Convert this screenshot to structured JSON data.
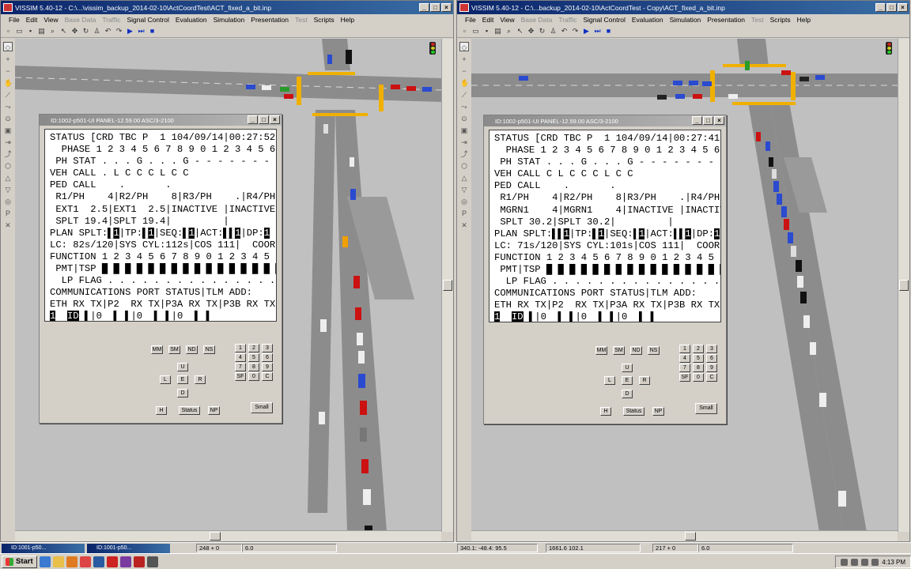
{
  "menu": [
    "File",
    "Edit",
    "View",
    "Base Data",
    "Traffic",
    "Signal Control",
    "Evaluation",
    "Simulation",
    "Presentation",
    "Test",
    "Scripts",
    "Help"
  ],
  "menu_disabled": [
    "Base Data",
    "Traffic",
    "Test"
  ],
  "windows": [
    {
      "title": "VISSIM 5.40-12 - C:\\...\\vissim_backup_2014-02-10\\ActCoordTest\\ACT_fixed_a_bit.inp",
      "panel_title": "ID:1002-p501-UI PANEL-12.59.00 ASC/3-2100",
      "lcd": {
        "l1": "STATUS [CRD TBC P  1 104/09/14|00:27:52",
        "l2": "  PHASE 1 2 3 4 5 6 7 8 9 0 1 2 3 4 5 6",
        "l3": " PH STAT . . . G . . . G - - - - - - - -",
        "l4": "VEH CALL . L C C C L C C",
        "l5": "PED CALL    .       .",
        "l6": " R1/PH    4|R2/PH    8|R3/PH    .|R4/PH    .",
        "l7": " EXT1  2.5|EXT1  2.5|INACTIVE |INACTIVE",
        "l8": " SPLT 19.4|SPLT 19.4|         |",
        "l9a": "PLAN SPLT:",
        "l9b": "|TP:",
        "l9c": "|SEQ:",
        "l9d": "|ACT:",
        "l9e": "|DP:",
        "l10": "LC: 82s/120|SYS CYL:112s|COS 111|  COORD",
        "l11": "FUNCTION 1 2 3 4 5 6 7 8 9 0 1 2 3 4 5 6",
        "l12a": " PMT|TSP ",
        "l13": "  LP FLAG . . . . . . . . . . . . . . . .",
        "l14": "COMMUNICATIONS PORT STATUS|TLM ADD:    0",
        "l15": "ETH RX TX|P2  RX TX|P3A RX TX|P3B RX TX",
        "l16a": "1",
        "l16b": "ID",
        "l16c": "0",
        "l16d": "0",
        "l16e": "0"
      }
    },
    {
      "title": "VISSIM 5.40-12 - C:\\...backup_2014-02-10\\ActCoordTest - Copy\\ACT_fixed_a_bit.inp",
      "panel_title": "ID:1002-p501-UI PANEL-12.59.00 ASC/3-2100",
      "lcd": {
        "l1": "STATUS [CRD TBC P  1 104/09/14|00:27:41",
        "l2": "  PHASE 1 2 3 4 5 6 7 8 9 0 1 2 3 4 5 6",
        "l3": " PH STAT . . . G . . . G - - - - - - - -",
        "l4": "VEH CALL C L C C C L C C",
        "l5": "PED CALL    .       .",
        "l6": " R1/PH    4|R2/PH    8|R3/PH    .|R4/PH    .",
        "l7": " MGRN1    4|MGRN1    4|INACTIVE |INACTIVE",
        "l8": " SPLT 30.2|SPLT 30.2|         |",
        "l9a": "PLAN SPLT:",
        "l9b": "|TP:",
        "l9c": "|SEQ:",
        "l9d": "|ACT:",
        "l9e": "|DP:",
        "l10": "LC: 71s/120|SYS CYL:101s|COS 111|  COORD",
        "l11": "FUNCTION 1 2 3 4 5 6 7 8 9 0 1 2 3 4 5 6",
        "l12a": " PMT|TSP ",
        "l13": "  LP FLAG . . . . . . . . . . . . . . . .",
        "l14": "COMMUNICATIONS PORT STATUS|TLM ADD:    0",
        "l15": "ETH RX TX|P2  RX TX|P3A RX TX|P3B RX TX",
        "l16a": "1",
        "l16b": "ID",
        "l16c": "0",
        "l16d": "0",
        "l16e": "0"
      }
    }
  ],
  "keypad": {
    "mode": [
      "MM",
      "SM",
      "ND",
      "NS"
    ],
    "dir_u": "U",
    "dir_l": "L",
    "dir_e": "E",
    "dir_r": "R",
    "dir_d": "D",
    "h": "H",
    "status": "Status",
    "np": "NP",
    "small": "Small",
    "num": [
      "1",
      "2",
      "3",
      "4",
      "5",
      "6",
      "7",
      "8",
      "9",
      "SF",
      "0",
      "C"
    ]
  },
  "statusbar": {
    "mini_left_1": "ID:1001-p50...",
    "mini_left_2": "ID:1001-p50...",
    "left_coords": "248 + 0",
    "left_speed": "6.0",
    "world_coords": "340.1: -48.4: 95.5",
    "right_pos": "1661.6  102.1",
    "right_coords": "217 + 0",
    "right_speed": "6.0"
  },
  "taskbar": {
    "start": "Start",
    "clock": "4:13 PM"
  },
  "colors": {
    "titlebar": "#0a246a",
    "road": "#8c8c8c",
    "signal_bar": "#f0b000",
    "lcd_bg": "#ffffff"
  }
}
